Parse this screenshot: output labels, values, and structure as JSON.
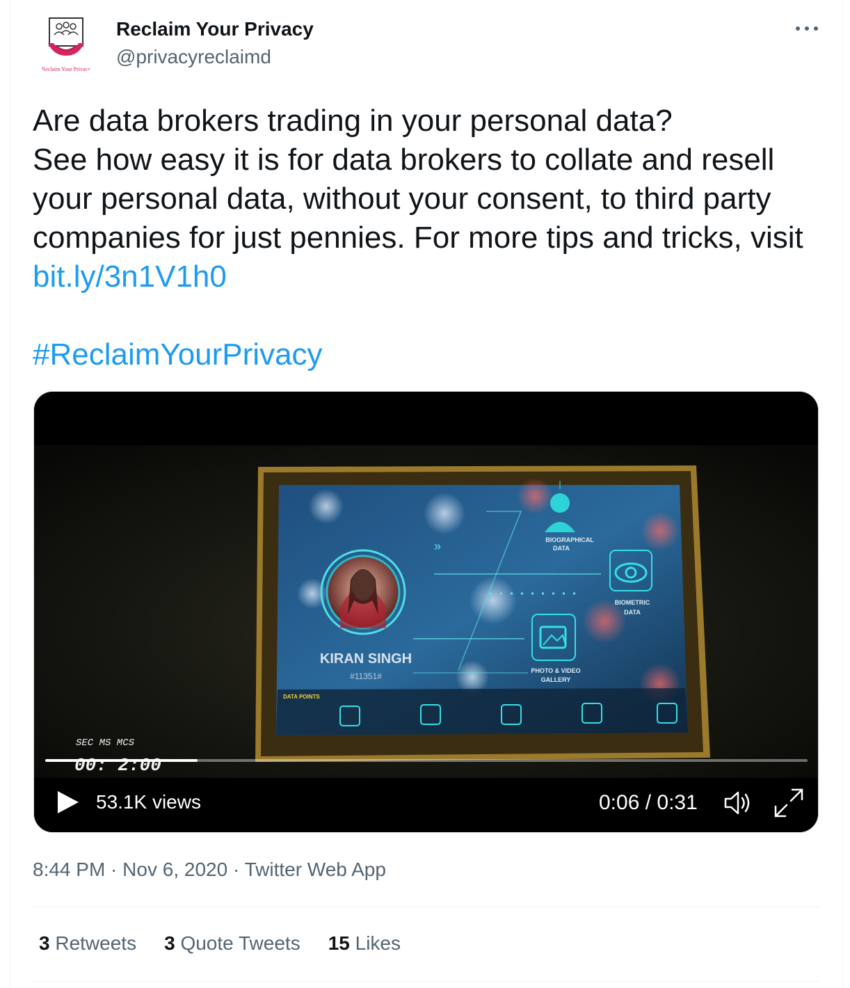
{
  "author": {
    "display_name": "Reclaim Your Privacy",
    "handle": "@privacyreclaimd",
    "avatar_logo_text": "Reclaim Your Privacy"
  },
  "more_icon": "more-horizontal-icon",
  "tweet": {
    "text_main": "Are data brokers trading in your personal data?\nSee how easy it is for data brokers to collate and resell your personal data, without your consent, to third party companies for just pennies. For more tips and tricks, visit ",
    "link": "bit.ly/3n1V1h0",
    "hashtag": "#ReclaimYourPrivacy"
  },
  "video": {
    "screen": {
      "person_name": "KIRAN SINGH",
      "person_id": "#11351#",
      "labels": [
        "BIOGRAPHICAL",
        "DATA",
        "BIOMETRIC",
        "DATA",
        "PHOTO & VIDEO",
        "GALLERY",
        "DATA POINTS"
      ],
      "timer_labels": "SEC  MS  MCS",
      "timer_value": "00: 2:00"
    },
    "progress": 0.2,
    "views": "53.1K views",
    "time": "0:06 / 0:31",
    "icons": [
      "play-icon",
      "volume-icon",
      "fullscreen-icon"
    ]
  },
  "meta": {
    "time": "8:44 PM",
    "date": "Nov 6, 2020",
    "separator": " · ",
    "source": "Twitter Web App"
  },
  "stats": [
    {
      "count": "3",
      "label": "Retweets"
    },
    {
      "count": "3",
      "label": "Quote Tweets"
    },
    {
      "count": "15",
      "label": "Likes"
    }
  ],
  "colors": {
    "link": "#1d9bf0",
    "text": "#0f1419",
    "secondary": "#536471",
    "brand_pink": "#d6245f"
  }
}
